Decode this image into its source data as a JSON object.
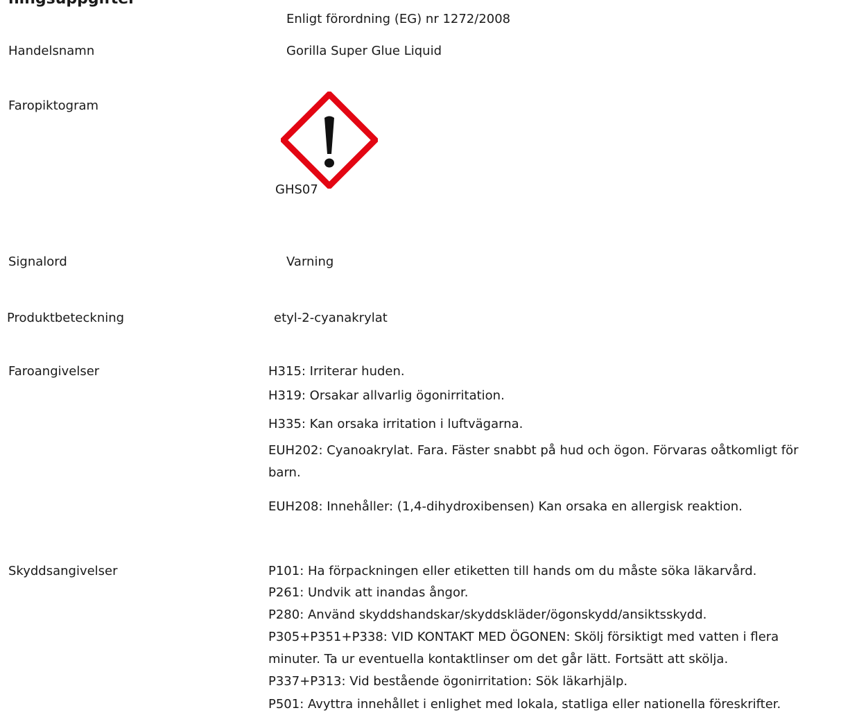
{
  "header": {
    "title_fragment": "ningsuppgifter",
    "regulation": "Enligt förordning (EG) nr 1272/2008"
  },
  "rows": {
    "trade_name": {
      "label": "Handelsnamn",
      "value": "Gorilla Super Glue Liquid"
    },
    "pictogram": {
      "label": "Faropiktogram",
      "code": "GHS07",
      "icon": "exclamation-mark-diamond-icon"
    },
    "signal_word": {
      "label": "Signalord",
      "value": "Varning"
    },
    "product_identifier": {
      "label": "Produktbeteckning",
      "value": "etyl-2-cyanakrylat"
    },
    "hazard_statements": {
      "label": "Faroangivelser",
      "items": [
        "H315: Irriterar huden.",
        "H319: Orsakar allvarlig ögonirritation.",
        "H335: Kan orsaka irritation i luftvägarna.",
        "EUH202: Cyanoakrylat. Fara. Fäster snabbt på hud och ögon. Förvaras oåtkomligt för barn.",
        "EUH208: Innehåller: (1,4-dihydroxibensen) Kan orsaka en allergisk reaktion."
      ]
    },
    "precautionary_statements": {
      "label": "Skyddsangivelser",
      "items": [
        "P101: Ha förpackningen eller etiketten till hands om du måste söka läkarvård.",
        "P261: Undvik att inandas ångor.",
        "P280: Använd skyddshandskar/skyddskläder/ögonskydd/ansiktsskydd.",
        "P305+P351+P338: VID KONTAKT MED ÖGONEN: Skölj försiktigt med vatten i flera minuter. Ta ur eventuella kontaktlinser om det går lätt. Fortsätt att skölja.",
        "P337+P313: Vid bestående ögonirritation:  Sök läkarhjälp.",
        "P501: Avyttra innehållet i enlighet med lokala, statliga eller nationella föreskrifter."
      ]
    }
  },
  "colors": {
    "pictogram_border": "#e30613",
    "text": "#1a1a1a"
  }
}
